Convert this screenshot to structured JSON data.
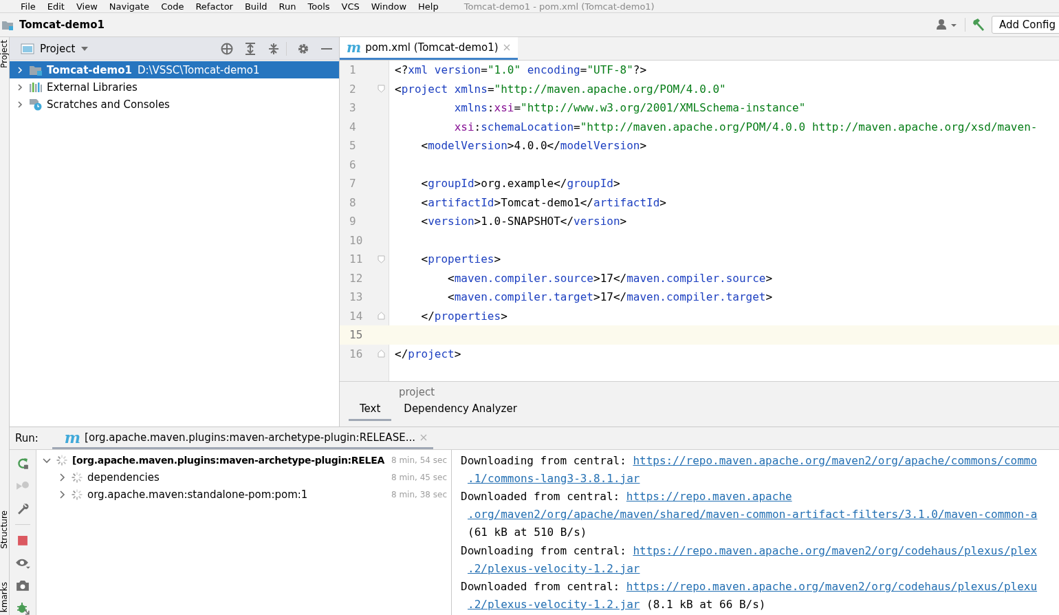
{
  "menu_bar": {
    "items": [
      "File",
      "Edit",
      "View",
      "Navigate",
      "Code",
      "Refactor",
      "Build",
      "Run",
      "Tools",
      "VCS",
      "Window",
      "Help"
    ],
    "window_title": "Tomcat-demo1 - pom.xml (Tomcat-demo1)"
  },
  "nav_bar": {
    "project": "Tomcat-demo1",
    "run_config_button": "Add Config"
  },
  "side_stripe": {
    "top_tabs": [
      "Project"
    ],
    "bottom_tabs": [
      "Structure",
      "kmarks"
    ]
  },
  "project_panel": {
    "title": "Project",
    "tree": [
      {
        "label": "Tomcat-demo1",
        "path": "D:\\VSSC\\Tomcat-demo1",
        "kind": "module",
        "selected": true,
        "expanded": false
      },
      {
        "label": "External Libraries",
        "kind": "libraries",
        "selected": false,
        "expanded": false
      },
      {
        "label": "Scratches and Consoles",
        "kind": "scratches",
        "selected": false,
        "expanded": false
      }
    ]
  },
  "editor": {
    "tabs": [
      {
        "icon_glyph": "m",
        "label": "pom.xml (Tomcat-demo1)",
        "selected": true
      }
    ],
    "lines": [
      {
        "number": "1",
        "current": false,
        "tokens": [
          {
            "kind": "p",
            "text": "<?"
          },
          {
            "kind": "n",
            "text": "xml version"
          },
          {
            "kind": "p",
            "text": "="
          },
          {
            "kind": "s",
            "text": "\"1.0\""
          },
          {
            "kind": "n",
            "text": " encoding"
          },
          {
            "kind": "p",
            "text": "="
          },
          {
            "kind": "s",
            "text": "\"UTF-8\""
          },
          {
            "kind": "p",
            "text": "?>"
          }
        ]
      },
      {
        "number": "2",
        "current": false,
        "fold_start": true,
        "tokens": [
          {
            "kind": "p",
            "text": "<"
          },
          {
            "kind": "n",
            "text": "project xmlns"
          },
          {
            "kind": "p",
            "text": "="
          },
          {
            "kind": "s",
            "text": "\"http://maven.apache.org/POM/4.0.0\""
          }
        ]
      },
      {
        "number": "3",
        "current": false,
        "tokens": [
          {
            "kind": "n",
            "text": "         xmlns"
          },
          {
            "kind": "p",
            "text": ":"
          },
          {
            "kind": "x",
            "text": "xsi"
          },
          {
            "kind": "p",
            "text": "="
          },
          {
            "kind": "s",
            "text": "\"http://www.w3.org/2001/XMLSchema-instance\""
          }
        ]
      },
      {
        "number": "4",
        "current": false,
        "tokens": [
          {
            "kind": "x",
            "text": "         xsi"
          },
          {
            "kind": "p",
            "text": ":"
          },
          {
            "kind": "n",
            "text": "schemaLocation"
          },
          {
            "kind": "p",
            "text": "="
          },
          {
            "kind": "s",
            "text": "\"http://maven.apache.org/POM/4.0.0 http://maven.apache.org/xsd/maven-"
          }
        ]
      },
      {
        "number": "5",
        "current": false,
        "tokens": [
          {
            "kind": "p",
            "text": "    <"
          },
          {
            "kind": "n",
            "text": "modelVersion"
          },
          {
            "kind": "p",
            "text": ">4.0.0</"
          },
          {
            "kind": "n",
            "text": "modelVersion"
          },
          {
            "kind": "p",
            "text": ">"
          }
        ]
      },
      {
        "number": "6",
        "current": false
      },
      {
        "number": "7",
        "current": false,
        "tokens": [
          {
            "kind": "p",
            "text": "    <"
          },
          {
            "kind": "n",
            "text": "groupId"
          },
          {
            "kind": "p",
            "text": ">org.example</"
          },
          {
            "kind": "n",
            "text": "groupId"
          },
          {
            "kind": "p",
            "text": ">"
          }
        ]
      },
      {
        "number": "8",
        "current": false,
        "tokens": [
          {
            "kind": "p",
            "text": "    <"
          },
          {
            "kind": "n",
            "text": "artifactId"
          },
          {
            "kind": "p",
            "text": ">Tomcat-demo1</"
          },
          {
            "kind": "n",
            "text": "artifactId"
          },
          {
            "kind": "p",
            "text": ">"
          }
        ]
      },
      {
        "number": "9",
        "current": false,
        "tokens": [
          {
            "kind": "p",
            "text": "    <"
          },
          {
            "kind": "n",
            "text": "version"
          },
          {
            "kind": "p",
            "text": ">1.0-SNAPSHOT</"
          },
          {
            "kind": "n",
            "text": "version"
          },
          {
            "kind": "p",
            "text": ">"
          }
        ]
      },
      {
        "number": "10",
        "current": false
      },
      {
        "number": "11",
        "current": false,
        "fold_start": true,
        "tokens": [
          {
            "kind": "p",
            "text": "    <"
          },
          {
            "kind": "n",
            "text": "properties"
          },
          {
            "kind": "p",
            "text": ">"
          }
        ]
      },
      {
        "number": "12",
        "current": false,
        "tokens": [
          {
            "kind": "p",
            "text": "        <"
          },
          {
            "kind": "n",
            "text": "maven.compiler.source"
          },
          {
            "kind": "p",
            "text": ">17</"
          },
          {
            "kind": "n",
            "text": "maven.compiler.source"
          },
          {
            "kind": "p",
            "text": ">"
          }
        ]
      },
      {
        "number": "13",
        "current": false,
        "tokens": [
          {
            "kind": "p",
            "text": "        <"
          },
          {
            "kind": "n",
            "text": "maven.compiler.target"
          },
          {
            "kind": "p",
            "text": ">17</"
          },
          {
            "kind": "n",
            "text": "maven.compiler.target"
          },
          {
            "kind": "p",
            "text": ">"
          }
        ]
      },
      {
        "number": "14",
        "current": false,
        "fold_end": true,
        "tokens": [
          {
            "kind": "p",
            "text": "    </"
          },
          {
            "kind": "n",
            "text": "properties"
          },
          {
            "kind": "p",
            "text": ">"
          }
        ]
      },
      {
        "number": "15",
        "current": true
      },
      {
        "number": "16",
        "current": false,
        "fold_end": true,
        "tokens": [
          {
            "kind": "p",
            "text": "</"
          },
          {
            "kind": "n",
            "text": "project"
          },
          {
            "kind": "p",
            "text": ">"
          }
        ]
      }
    ],
    "breadcrumb": "project",
    "bottom_tabs": [
      {
        "label": "Text",
        "selected": true
      },
      {
        "label": "Dependency Analyzer",
        "selected": false
      }
    ]
  },
  "run_panel": {
    "label": "Run:",
    "tabs": [
      {
        "icon_glyph": "m",
        "label": "[org.apache.maven.plugins:maven-archetype-plugin:RELEASE...",
        "selected": true
      }
    ],
    "tree": [
      {
        "label": "[org.apache.maven.plugins:maven-archetype-plugin:RELEA",
        "time": "8 min, 54 sec",
        "expanded": true,
        "children": [
          {
            "label": "dependencies",
            "time": "8 min, 45 sec",
            "expanded": false
          },
          {
            "label": "org.apache.maven:standalone-pom:pom:1",
            "time": "8 min, 38 sec",
            "expanded": false
          }
        ]
      }
    ],
    "console": [
      {
        "kind": "line",
        "parts": [
          {
            "kind": "plain",
            "text": "Downloading from central: "
          },
          {
            "kind": "link",
            "text": "https://repo.maven.apache.org/maven2/org/apache/commons/commo"
          }
        ]
      },
      {
        "kind": "wrap",
        "parts": [
          {
            "kind": "link",
            "text": ".1/commons-lang3-3.8.1.jar"
          }
        ]
      },
      {
        "kind": "line",
        "parts": [
          {
            "kind": "plain",
            "text": "Downloaded from central: "
          },
          {
            "kind": "link",
            "text": "https://repo.maven.apache"
          }
        ]
      },
      {
        "kind": "wrap",
        "parts": [
          {
            "kind": "link",
            "text": ".org/maven2/org/apache/maven/shared/maven-common-artifact-filters/3.1.0/maven-common-a"
          }
        ]
      },
      {
        "kind": "wrap",
        "parts": [
          {
            "kind": "plain",
            "text": "(61 kB at 510 B/s)"
          }
        ]
      },
      {
        "kind": "line",
        "parts": [
          {
            "kind": "plain",
            "text": "Downloading from central: "
          },
          {
            "kind": "link",
            "text": "https://repo.maven.apache.org/maven2/org/codehaus/plexus/plex"
          }
        ]
      },
      {
        "kind": "wrap",
        "parts": [
          {
            "kind": "link",
            "text": ".2/plexus-velocity-1.2.jar"
          }
        ]
      },
      {
        "kind": "line",
        "parts": [
          {
            "kind": "plain",
            "text": "Downloaded from central: "
          },
          {
            "kind": "link",
            "text": "https://repo.maven.apache.org/maven2/org/codehaus/plexus/plexu"
          }
        ]
      },
      {
        "kind": "wrap",
        "parts": [
          {
            "kind": "link",
            "text": ".2/plexus-velocity-1.2.jar"
          },
          {
            "kind": "plain",
            "text": " (8.1 kB at 66 B/s)"
          }
        ]
      }
    ]
  }
}
